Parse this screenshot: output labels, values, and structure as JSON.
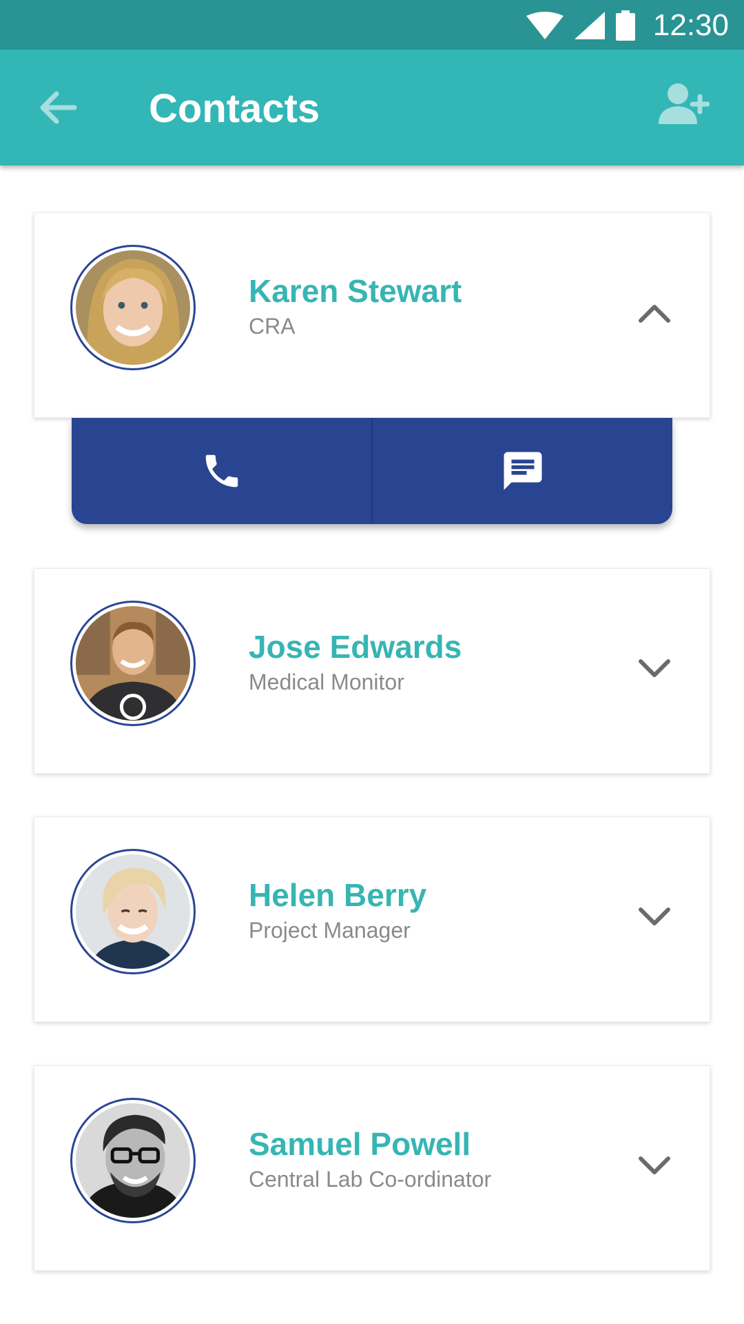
{
  "status_bar": {
    "time": "12:30",
    "icons": [
      "wifi-icon",
      "signal-icon",
      "battery-icon"
    ]
  },
  "app_bar": {
    "title": "Contacts",
    "back_icon": "arrow-back-icon",
    "action_icon": "add-person-icon"
  },
  "colors": {
    "status_bar": "#2a9393",
    "app_bar": "#33b6b6",
    "accent": "#36b5b3",
    "action_panel": "#294491",
    "avatar_ring": "#2b4594"
  },
  "contacts": [
    {
      "name": "Karen Stewart",
      "role": "CRA",
      "expanded": true
    },
    {
      "name": "Jose Edwards",
      "role": "Medical Monitor",
      "expanded": false
    },
    {
      "name": "Helen Berry",
      "role": "Project Manager",
      "expanded": false
    },
    {
      "name": "Samuel Powell",
      "role": "Central Lab Co-ordinator",
      "expanded": false
    }
  ],
  "actions": [
    {
      "icon": "phone-icon"
    },
    {
      "icon": "message-icon"
    }
  ]
}
